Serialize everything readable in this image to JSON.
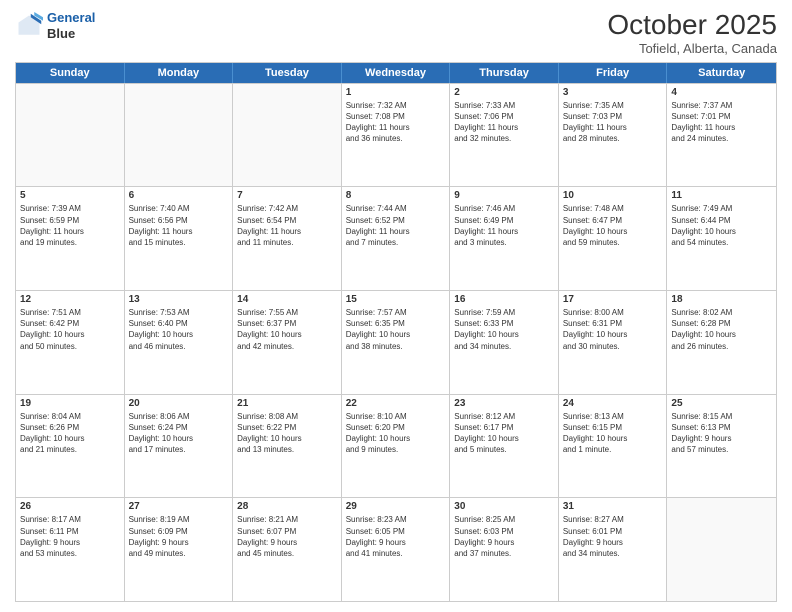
{
  "header": {
    "logo_line1": "General",
    "logo_line2": "Blue",
    "month": "October 2025",
    "location": "Tofield, Alberta, Canada"
  },
  "weekdays": [
    "Sunday",
    "Monday",
    "Tuesday",
    "Wednesday",
    "Thursday",
    "Friday",
    "Saturday"
  ],
  "rows": [
    [
      {
        "day": "",
        "text": "",
        "shaded": true,
        "empty": true
      },
      {
        "day": "",
        "text": "",
        "shaded": true,
        "empty": true
      },
      {
        "day": "",
        "text": "",
        "shaded": true,
        "empty": true
      },
      {
        "day": "1",
        "text": "Sunrise: 7:32 AM\nSunset: 7:08 PM\nDaylight: 11 hours\nand 36 minutes."
      },
      {
        "day": "2",
        "text": "Sunrise: 7:33 AM\nSunset: 7:06 PM\nDaylight: 11 hours\nand 32 minutes."
      },
      {
        "day": "3",
        "text": "Sunrise: 7:35 AM\nSunset: 7:03 PM\nDaylight: 11 hours\nand 28 minutes."
      },
      {
        "day": "4",
        "text": "Sunrise: 7:37 AM\nSunset: 7:01 PM\nDaylight: 11 hours\nand 24 minutes."
      }
    ],
    [
      {
        "day": "5",
        "text": "Sunrise: 7:39 AM\nSunset: 6:59 PM\nDaylight: 11 hours\nand 19 minutes."
      },
      {
        "day": "6",
        "text": "Sunrise: 7:40 AM\nSunset: 6:56 PM\nDaylight: 11 hours\nand 15 minutes."
      },
      {
        "day": "7",
        "text": "Sunrise: 7:42 AM\nSunset: 6:54 PM\nDaylight: 11 hours\nand 11 minutes."
      },
      {
        "day": "8",
        "text": "Sunrise: 7:44 AM\nSunset: 6:52 PM\nDaylight: 11 hours\nand 7 minutes."
      },
      {
        "day": "9",
        "text": "Sunrise: 7:46 AM\nSunset: 6:49 PM\nDaylight: 11 hours\nand 3 minutes."
      },
      {
        "day": "10",
        "text": "Sunrise: 7:48 AM\nSunset: 6:47 PM\nDaylight: 10 hours\nand 59 minutes."
      },
      {
        "day": "11",
        "text": "Sunrise: 7:49 AM\nSunset: 6:44 PM\nDaylight: 10 hours\nand 54 minutes."
      }
    ],
    [
      {
        "day": "12",
        "text": "Sunrise: 7:51 AM\nSunset: 6:42 PM\nDaylight: 10 hours\nand 50 minutes."
      },
      {
        "day": "13",
        "text": "Sunrise: 7:53 AM\nSunset: 6:40 PM\nDaylight: 10 hours\nand 46 minutes."
      },
      {
        "day": "14",
        "text": "Sunrise: 7:55 AM\nSunset: 6:37 PM\nDaylight: 10 hours\nand 42 minutes."
      },
      {
        "day": "15",
        "text": "Sunrise: 7:57 AM\nSunset: 6:35 PM\nDaylight: 10 hours\nand 38 minutes."
      },
      {
        "day": "16",
        "text": "Sunrise: 7:59 AM\nSunset: 6:33 PM\nDaylight: 10 hours\nand 34 minutes."
      },
      {
        "day": "17",
        "text": "Sunrise: 8:00 AM\nSunset: 6:31 PM\nDaylight: 10 hours\nand 30 minutes."
      },
      {
        "day": "18",
        "text": "Sunrise: 8:02 AM\nSunset: 6:28 PM\nDaylight: 10 hours\nand 26 minutes."
      }
    ],
    [
      {
        "day": "19",
        "text": "Sunrise: 8:04 AM\nSunset: 6:26 PM\nDaylight: 10 hours\nand 21 minutes."
      },
      {
        "day": "20",
        "text": "Sunrise: 8:06 AM\nSunset: 6:24 PM\nDaylight: 10 hours\nand 17 minutes."
      },
      {
        "day": "21",
        "text": "Sunrise: 8:08 AM\nSunset: 6:22 PM\nDaylight: 10 hours\nand 13 minutes."
      },
      {
        "day": "22",
        "text": "Sunrise: 8:10 AM\nSunset: 6:20 PM\nDaylight: 10 hours\nand 9 minutes."
      },
      {
        "day": "23",
        "text": "Sunrise: 8:12 AM\nSunset: 6:17 PM\nDaylight: 10 hours\nand 5 minutes."
      },
      {
        "day": "24",
        "text": "Sunrise: 8:13 AM\nSunset: 6:15 PM\nDaylight: 10 hours\nand 1 minute."
      },
      {
        "day": "25",
        "text": "Sunrise: 8:15 AM\nSunset: 6:13 PM\nDaylight: 9 hours\nand 57 minutes."
      }
    ],
    [
      {
        "day": "26",
        "text": "Sunrise: 8:17 AM\nSunset: 6:11 PM\nDaylight: 9 hours\nand 53 minutes."
      },
      {
        "day": "27",
        "text": "Sunrise: 8:19 AM\nSunset: 6:09 PM\nDaylight: 9 hours\nand 49 minutes."
      },
      {
        "day": "28",
        "text": "Sunrise: 8:21 AM\nSunset: 6:07 PM\nDaylight: 9 hours\nand 45 minutes."
      },
      {
        "day": "29",
        "text": "Sunrise: 8:23 AM\nSunset: 6:05 PM\nDaylight: 9 hours\nand 41 minutes."
      },
      {
        "day": "30",
        "text": "Sunrise: 8:25 AM\nSunset: 6:03 PM\nDaylight: 9 hours\nand 37 minutes."
      },
      {
        "day": "31",
        "text": "Sunrise: 8:27 AM\nSunset: 6:01 PM\nDaylight: 9 hours\nand 34 minutes."
      },
      {
        "day": "",
        "text": "",
        "shaded": true,
        "empty": true
      }
    ]
  ]
}
